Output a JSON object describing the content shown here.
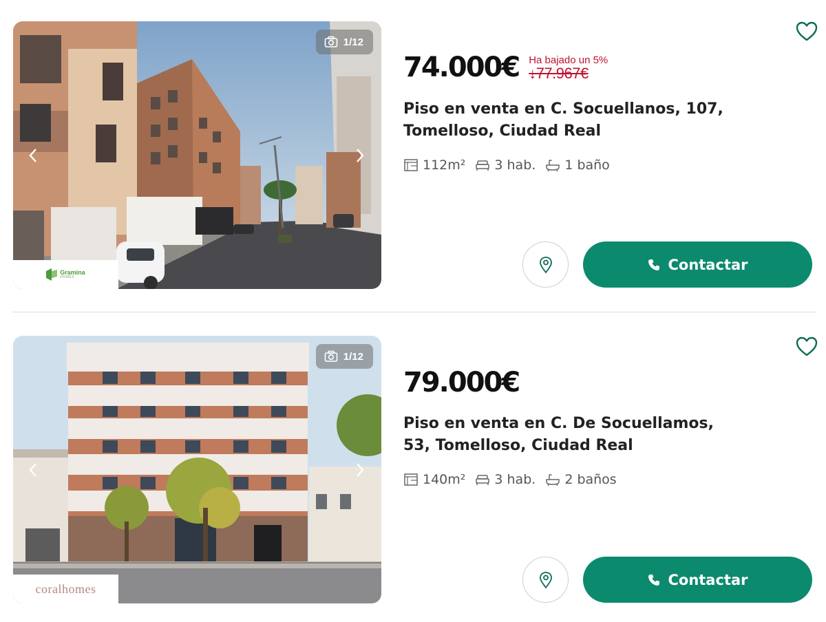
{
  "listings": [
    {
      "price": "74.000€",
      "price_drop_label": "Ha bajado un 5%",
      "old_price": "↓77.967€",
      "title": "Piso en venta en C. Socuellanos, 107, Tomelloso, Ciudad Real",
      "photo_counter": "1/12",
      "area": "112m²",
      "rooms": "3 hab.",
      "baths": "1 baño",
      "agency_logo_text": "Gramina",
      "agency_logo_sub": "HOMES",
      "contact_label": "Contactar"
    },
    {
      "price": "79.000€",
      "title": "Piso en venta en C. De Socuellamos, 53, Tomelloso, Ciudad Real",
      "photo_counter": "1/12",
      "area": "140m²",
      "rooms": "3 hab.",
      "baths": "2 baños",
      "agency_logo_text": "coralhomes",
      "contact_label": "Contactar"
    }
  ],
  "colors": {
    "accent": "#0c8a6e",
    "price_drop": "#c0112f",
    "favorite_outline": "#0c6b56"
  },
  "icons": {
    "favorite": "heart-outline-icon",
    "photo_counter": "camera-icon",
    "prev": "chevron-left-icon",
    "next": "chevron-right-icon",
    "area": "floorplan-icon",
    "rooms": "bed-icon",
    "baths": "bathtub-icon",
    "map": "map-pin-icon",
    "contact": "phone-icon"
  }
}
